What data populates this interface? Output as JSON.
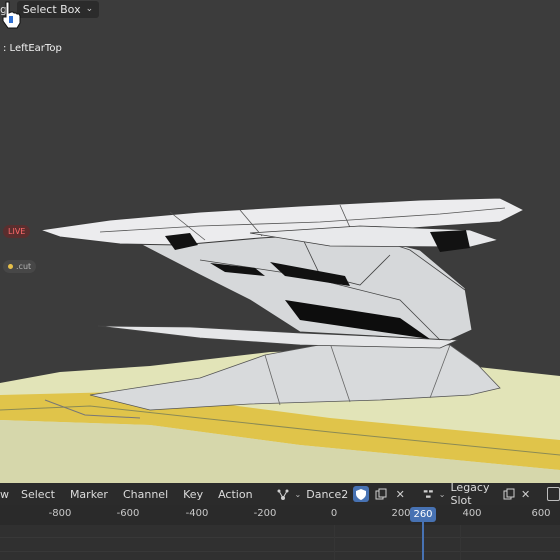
{
  "viewport": {
    "tool_label": "g:",
    "tool_select": "Select Box",
    "object_name": ": LeftEarTop",
    "live_badge": "LIVE",
    "cut_badge": ".cut"
  },
  "dopesheet": {
    "menu": [
      "w",
      "Select",
      "Marker",
      "Channel",
      "Key",
      "Action"
    ],
    "action_name": "Dance2",
    "slot_label": "Legacy Slot"
  },
  "timeline": {
    "ticks": [
      "-800",
      "-600",
      "-400",
      "-200",
      "0",
      "200",
      "400",
      "600"
    ],
    "current_frame": "260"
  },
  "colors": {
    "accent": "#4772b3",
    "viewport_bg": "#3c3c3c",
    "mesh_face": "#d9dadb",
    "selected_edge": "#e5c84a"
  },
  "icons": [
    "chevron-down-icon",
    "action-type-icon",
    "fake-user-shield-icon",
    "duplicate-icon",
    "close-icon",
    "slot-icon",
    "pointing-hand-cursor-icon"
  ]
}
